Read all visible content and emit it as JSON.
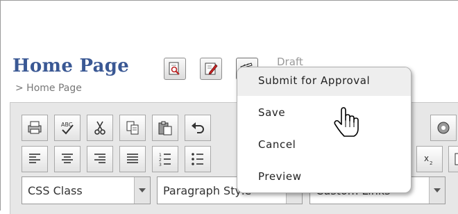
{
  "page": {
    "title": "Home Page",
    "breadcrumb": "> Home Page",
    "status": "Draft"
  },
  "header_buttons": [
    {
      "name": "preview-page-icon"
    },
    {
      "name": "edit-page-icon"
    },
    {
      "name": "workflow-clapper-icon"
    }
  ],
  "dropdown_menu": {
    "items": [
      {
        "label": "Submit for Approval"
      },
      {
        "label": "Save"
      },
      {
        "label": "Cancel"
      },
      {
        "label": "Preview"
      }
    ]
  },
  "toolbar": {
    "row1_icons": [
      "print-icon",
      "spellcheck-icon",
      "cut-icon",
      "copy-icon",
      "paste-icon",
      "undo-icon"
    ],
    "row2_icons": [
      "align-left-icon",
      "align-center-icon",
      "align-right-icon",
      "justify-icon",
      "numbered-list-icon",
      "bullet-list-icon"
    ]
  },
  "selects": {
    "css_class": "CSS Class",
    "paragraph_style": "Paragraph Style",
    "custom_links": "Custom Links"
  },
  "colors": {
    "title": "#3a5894",
    "draft_text": "#9a9a9a",
    "menu_highlight": "#eeeeee"
  }
}
